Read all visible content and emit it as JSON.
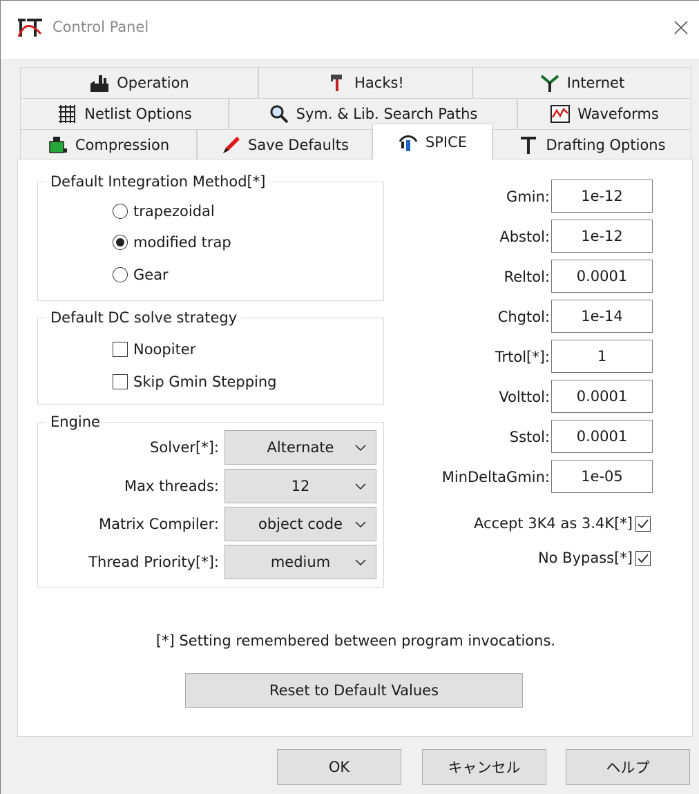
{
  "window": {
    "title": "Control Panel",
    "close_icon": "close-icon"
  },
  "tabs": {
    "row1": [
      {
        "label": "Operation",
        "icon": "factory-icon"
      },
      {
        "label": "Hacks!",
        "icon": "tools-icon"
      },
      {
        "label": "Internet",
        "icon": "antenna-icon"
      }
    ],
    "row2": [
      {
        "label": "Netlist Options",
        "icon": "grid-icon"
      },
      {
        "label": "Sym. & Lib. Search Paths",
        "icon": "magnifier-icon"
      },
      {
        "label": "Waveforms",
        "icon": "waveform-icon"
      }
    ],
    "row3": [
      {
        "label": "Compression",
        "icon": "compression-icon"
      },
      {
        "label": "Save Defaults",
        "icon": "pen-icon"
      },
      {
        "label": "SPICE",
        "icon": "spice-icon",
        "active": true
      },
      {
        "label": "Drafting Options",
        "icon": "t-square-icon"
      }
    ]
  },
  "integration": {
    "title": "Default Integration Method[*]",
    "options": [
      "trapezoidal",
      "modified trap",
      "Gear"
    ],
    "selected": "modified trap"
  },
  "dc": {
    "title": "Default DC solve strategy",
    "options": [
      {
        "label": "Noopiter",
        "checked": false
      },
      {
        "label": "Skip Gmin Stepping",
        "checked": false
      }
    ]
  },
  "engine": {
    "title": "Engine",
    "fields": [
      {
        "label": "Solver[*]:",
        "value": "Alternate"
      },
      {
        "label": "Max threads:",
        "value": "12"
      },
      {
        "label": "Matrix Compiler:",
        "value": "object code"
      },
      {
        "label": "Thread Priority[*]:",
        "value": "medium"
      }
    ]
  },
  "params": [
    {
      "label": "Gmin:",
      "value": "1e-12"
    },
    {
      "label": "Abstol:",
      "value": "1e-12"
    },
    {
      "label": "Reltol:",
      "value": "0.0001"
    },
    {
      "label": "Chgtol:",
      "value": "1e-14"
    },
    {
      "label": "Trtol[*]:",
      "value": "1"
    },
    {
      "label": "Volttol:",
      "value": "0.0001"
    },
    {
      "label": "Sstol:",
      "value": "0.0001"
    },
    {
      "label": "MinDeltaGmin:",
      "value": "1e-05"
    }
  ],
  "right_checks": [
    {
      "label": "Accept 3K4 as 3.4K[*]",
      "checked": true
    },
    {
      "label": "No Bypass[*]",
      "checked": true
    }
  ],
  "note": "[*] Setting remembered between program invocations.",
  "reset_label": "Reset to Default Values",
  "footer": {
    "ok": "OK",
    "cancel": "キャンセル",
    "help": "ヘルプ"
  }
}
